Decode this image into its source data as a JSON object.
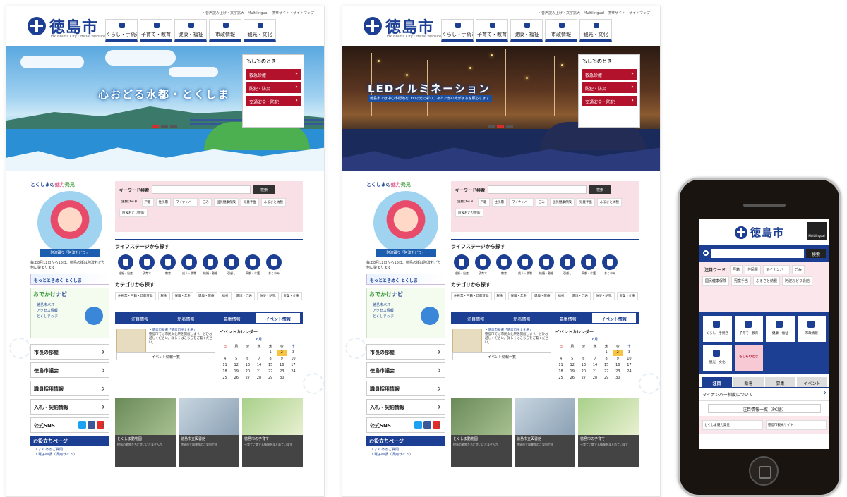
{
  "site": {
    "logo_text": "徳島市",
    "logo_sub": "Tokushima City Official Website",
    "util_links": "・音声読み上げ・文字拡大・Multilingual・携帯サイト・サイトマップ",
    "nav": [
      "くらし・手続き",
      "子育て・教育",
      "健康・福祉",
      "市政情報",
      "観光・文化"
    ]
  },
  "hero_day": {
    "title": "心おどる水都・とくしま"
  },
  "hero_night": {
    "title": "LEDイルミネーション",
    "sub": "徳島市では中心市街地をLEDの光で彩り、あたたかい光がまちを照らします"
  },
  "mosimo": {
    "heading": "もしものとき",
    "items": [
      "救急診療",
      "防犯・防災",
      "交通安全・防犯"
    ]
  },
  "side": {
    "charm_title_a": "とくしまの",
    "charm_title_b": "魅力",
    "charm_title_c": "発見",
    "charm_caption": "阿波踊り「阿波おどり」",
    "charm_text": "毎年8月12日から15日、徳島の街は阿波おどり一色に染まります",
    "banner": "もっとときめく とくしま",
    "navi_a": "おでかけ",
    "navi_b": "ナビ",
    "navi_links": [
      "・徳島市バス",
      "・アクセス情報",
      "・とくしまっぷ"
    ],
    "links": [
      "市長の部屋",
      "徳島市議会",
      "職員採用情報",
      "入札・契約情報"
    ],
    "sns": "公式SNS",
    "oyaku": "お役立ちページ",
    "oyaku_links": [
      "・よくあるご質問",
      "・電子申請（汎用サイト）"
    ]
  },
  "search": {
    "label": "キーワード検索",
    "button": "検索",
    "tags_label": "注目ワード",
    "tags": [
      "戸籍",
      "住民票",
      "マイナンバー",
      "ごみ",
      "国民健康保険",
      "児童手当",
      "ふるさと納税",
      "阿波おどり会館"
    ]
  },
  "life": {
    "title": "ライフステージから探す",
    "items": [
      "妊娠・出産",
      "子育て",
      "教育",
      "成人・就職",
      "結婚・離婚",
      "引越し",
      "高齢・介護",
      "おくやみ"
    ]
  },
  "category": {
    "title": "カテゴリから探す",
    "tags": [
      "住民票・戸籍・印鑑登録",
      "税金",
      "保険・年金",
      "健康・医療",
      "福祉",
      "環境・ごみ",
      "防災・防犯",
      "産業・仕事"
    ]
  },
  "tabs": {
    "items": [
      "注目情報",
      "新着情報",
      "募集情報",
      "イベント情報"
    ],
    "active": 3,
    "news_title": "・徳島市長選「徳島市民文化祭」",
    "news_text": "徳島市では市民文化祭を開催します。ぜひお越しください。詳しくはこちらをご覧ください。",
    "more": "イベント情報一覧"
  },
  "calendar": {
    "title": "イベントカレンダー",
    "month": "6月",
    "weekdays": [
      "日",
      "月",
      "火",
      "水",
      "木",
      "金",
      "土"
    ],
    "days": [
      "",
      "",
      "",
      "",
      "1",
      "2",
      "3",
      "4",
      "5",
      "6",
      "7",
      "8",
      "9",
      "10",
      "11",
      "12",
      "13",
      "14",
      "15",
      "16",
      "17",
      "18",
      "19",
      "20",
      "21",
      "22",
      "23",
      "24",
      "25",
      "26",
      "27",
      "28",
      "29",
      "30"
    ],
    "highlight": "2"
  },
  "photos": [
    {
      "title": "とくしま動物園",
      "desc": "徳島の動物たちに会いにきませんか"
    },
    {
      "title": "徳島市立図書館",
      "desc": "徳島市立図書館のご案内です"
    },
    {
      "title": "徳島市の子育て",
      "desc": "子育てに関する情報をまとめています"
    }
  ],
  "phone": {
    "logo": "徳島市",
    "multilingual": "Multilingual",
    "search_btn": "検索",
    "tags_label": "注目ワード",
    "tags": [
      "戸籍",
      "住民票",
      "マイナンバー",
      "ごみ",
      "国民健康保険",
      "児童手当",
      "ふるさと納税",
      "阿波おどり会館"
    ],
    "grid": [
      "くらし・手続き",
      "子育て・教育",
      "健康・福祉",
      "市政情報",
      "観光・文化",
      "もしものとき"
    ],
    "tabs": [
      "注目",
      "新着",
      "募集",
      "イベント"
    ],
    "news": "マイナンバー制度について",
    "more": "注目情報一覧（PC版）",
    "bottom": [
      "とくしま魅力発見",
      "徳島市観光サイト"
    ]
  },
  "colors": {
    "brand": "#1c3f94",
    "alert": "#b3122c",
    "pink": "#f9dfe6"
  }
}
